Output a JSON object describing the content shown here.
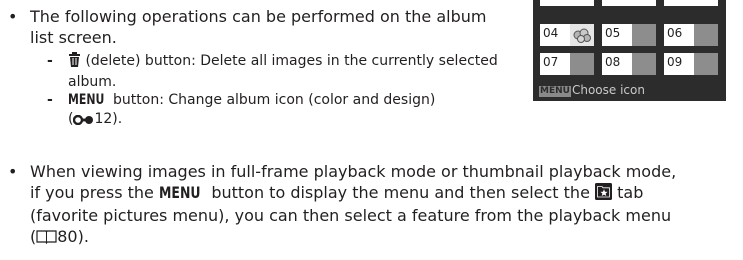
{
  "bullet1": {
    "symbol": "•",
    "text": "The following operations can be performed on the album list screen."
  },
  "sub1": {
    "dash": "-",
    "icon": "trash-icon",
    "text": "(delete) button: Delete all images in the currently selected album."
  },
  "sub2": {
    "dash": "-",
    "menu_word": "MENU",
    "text": "button: Change album icon (color and design)",
    "ref_icon": "link-icon",
    "ref": "12)."
  },
  "bullet2": {
    "symbol": "•",
    "line1": "When viewing images in full-frame playback mode or thumbnail playback mode,",
    "line2_a": "if you press the",
    "menu_word": "MENU",
    "line2_b": "button to display the menu and then select the",
    "line2_c": "tab",
    "tab_icon": "favorite-star-tab-icon",
    "line3": "(favorite pictures menu), you can then select a feature from the playback menu",
    "ref_icon": "book-icon",
    "ref": "80)."
  },
  "screen": {
    "cells": [
      "04",
      "05",
      "06",
      "07",
      "08",
      "09"
    ],
    "menu_badge": "MENU",
    "footer": "Choose icon"
  }
}
